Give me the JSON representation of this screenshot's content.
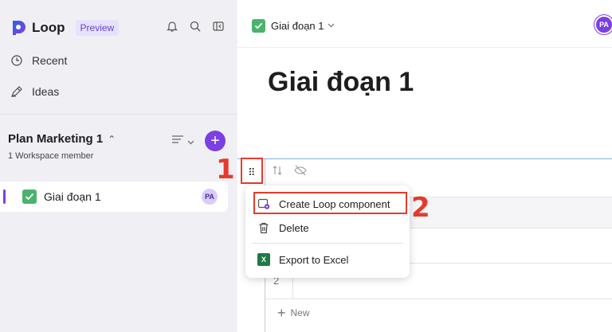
{
  "app": {
    "name": "Loop",
    "badge": "Preview"
  },
  "sidebar": {
    "nav": [
      {
        "label": "Recent",
        "icon": "clock-icon"
      },
      {
        "label": "Ideas",
        "icon": "pen-icon"
      }
    ],
    "workspace": {
      "title": "Plan Marketing 1",
      "subtitle": "1 Workspace member"
    },
    "pages": [
      {
        "label": "Giai đoạn 1",
        "avatar": "PA"
      }
    ]
  },
  "topbar": {
    "breadcrumb": "Giai đoạn 1",
    "avatar": "PA"
  },
  "main": {
    "title": "Giai đoạn 1",
    "rows": [
      "2"
    ],
    "new_label": "New"
  },
  "context_menu": {
    "items": [
      {
        "label": "Create Loop component"
      },
      {
        "label": "Delete"
      },
      {
        "label": "Export to Excel"
      }
    ]
  },
  "annotations": {
    "step1": "1",
    "step2": "2"
  },
  "colors": {
    "accent": "#7b3fe4",
    "highlight": "#e53b2c",
    "check_green": "#4bb36e"
  }
}
